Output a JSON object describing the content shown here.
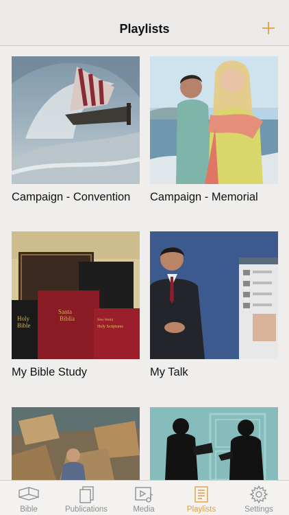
{
  "navbar": {
    "title": "Playlists",
    "add_icon": "plus-icon",
    "accent": "#e0a040"
  },
  "playlists": [
    {
      "label": "Campaign - Convention",
      "thumb": "ship-storm-painting"
    },
    {
      "label": "Campaign - Memorial",
      "thumb": "couple-beach-photo"
    },
    {
      "label": "My Bible Study",
      "thumb": "bibles-photo"
    },
    {
      "label": "My Talk",
      "thumb": "speaker-video-photo"
    },
    {
      "label": "",
      "thumb": "crowd-ruins-painting"
    },
    {
      "label": "",
      "thumb": "silhouettes-door-illustration"
    }
  ],
  "tabbar": {
    "items": [
      {
        "label": "Bible",
        "icon": "open-book-icon"
      },
      {
        "label": "Publications",
        "icon": "stacked-pages-icon"
      },
      {
        "label": "Media",
        "icon": "media-icon"
      },
      {
        "label": "Playlists",
        "icon": "playlist-icon",
        "active": true
      },
      {
        "label": "Settings",
        "icon": "gear-icon"
      }
    ]
  }
}
